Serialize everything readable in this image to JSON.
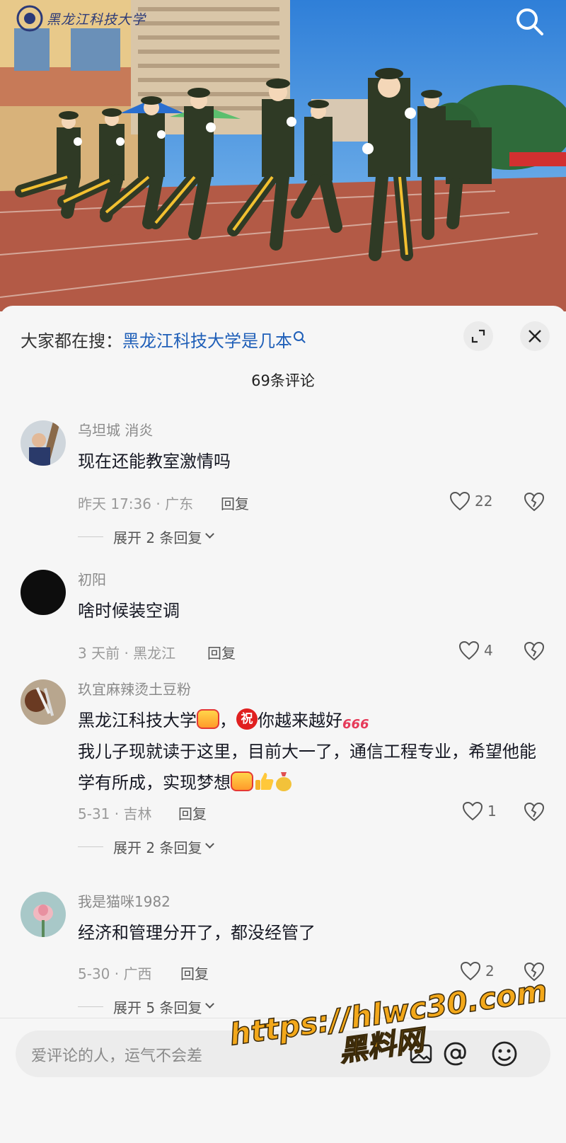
{
  "video": {
    "logo_text": "黑龙江科技大学"
  },
  "trending": {
    "prefix": "大家都在搜：",
    "keyword": "黑龙江科技大学是几本"
  },
  "comment_count": "69条评论",
  "comments": [
    {
      "username": "乌坦城 消炎",
      "text": "现在还能教室激情吗",
      "meta": "昨天 17:36 · 广东",
      "reply": "回复",
      "likes": "22",
      "expand": "展开 2 条回复"
    },
    {
      "username": "初阳",
      "text": "啥时候装空调",
      "meta": "3 天前 · 黑龙江",
      "reply": "回复",
      "likes": "4"
    },
    {
      "username": "玖宜麻辣烫土豆粉",
      "text_part1": "黑龙江科技大学",
      "text_part2": "，",
      "emoji_zhu": "祝",
      "text_part3": "你越来越好",
      "emoji_666": "666",
      "text_line2": "我儿子现就读于这里，目前大一了，通信工程专业，希望他能学有所成，实现梦想",
      "emoji_jiayou": "加油",
      "meta": "5-31 · 吉林",
      "reply": "回复",
      "likes": "1",
      "expand": "展开 2 条回复"
    },
    {
      "username": "我是猫咪1982",
      "text": "经济和管理分开了，都没经管了",
      "meta": "5-30 · 广西",
      "reply": "回复",
      "likes": "2",
      "expand": "展开 5 条回复"
    }
  ],
  "input": {
    "placeholder": "爱评论的人，运气不会差"
  },
  "watermark": {
    "url": "https://hlwc30.com",
    "site": "黑料网"
  },
  "colors": {
    "keyword": "#1f5fb8",
    "watermark": "#f3a81a",
    "track": "#b35a46",
    "sky": "#3b8de0"
  },
  "icons": [
    "search-icon",
    "expand-icon",
    "close-icon",
    "heart-icon",
    "broken-heart-icon",
    "image-icon",
    "at-icon",
    "emoji-icon"
  ]
}
